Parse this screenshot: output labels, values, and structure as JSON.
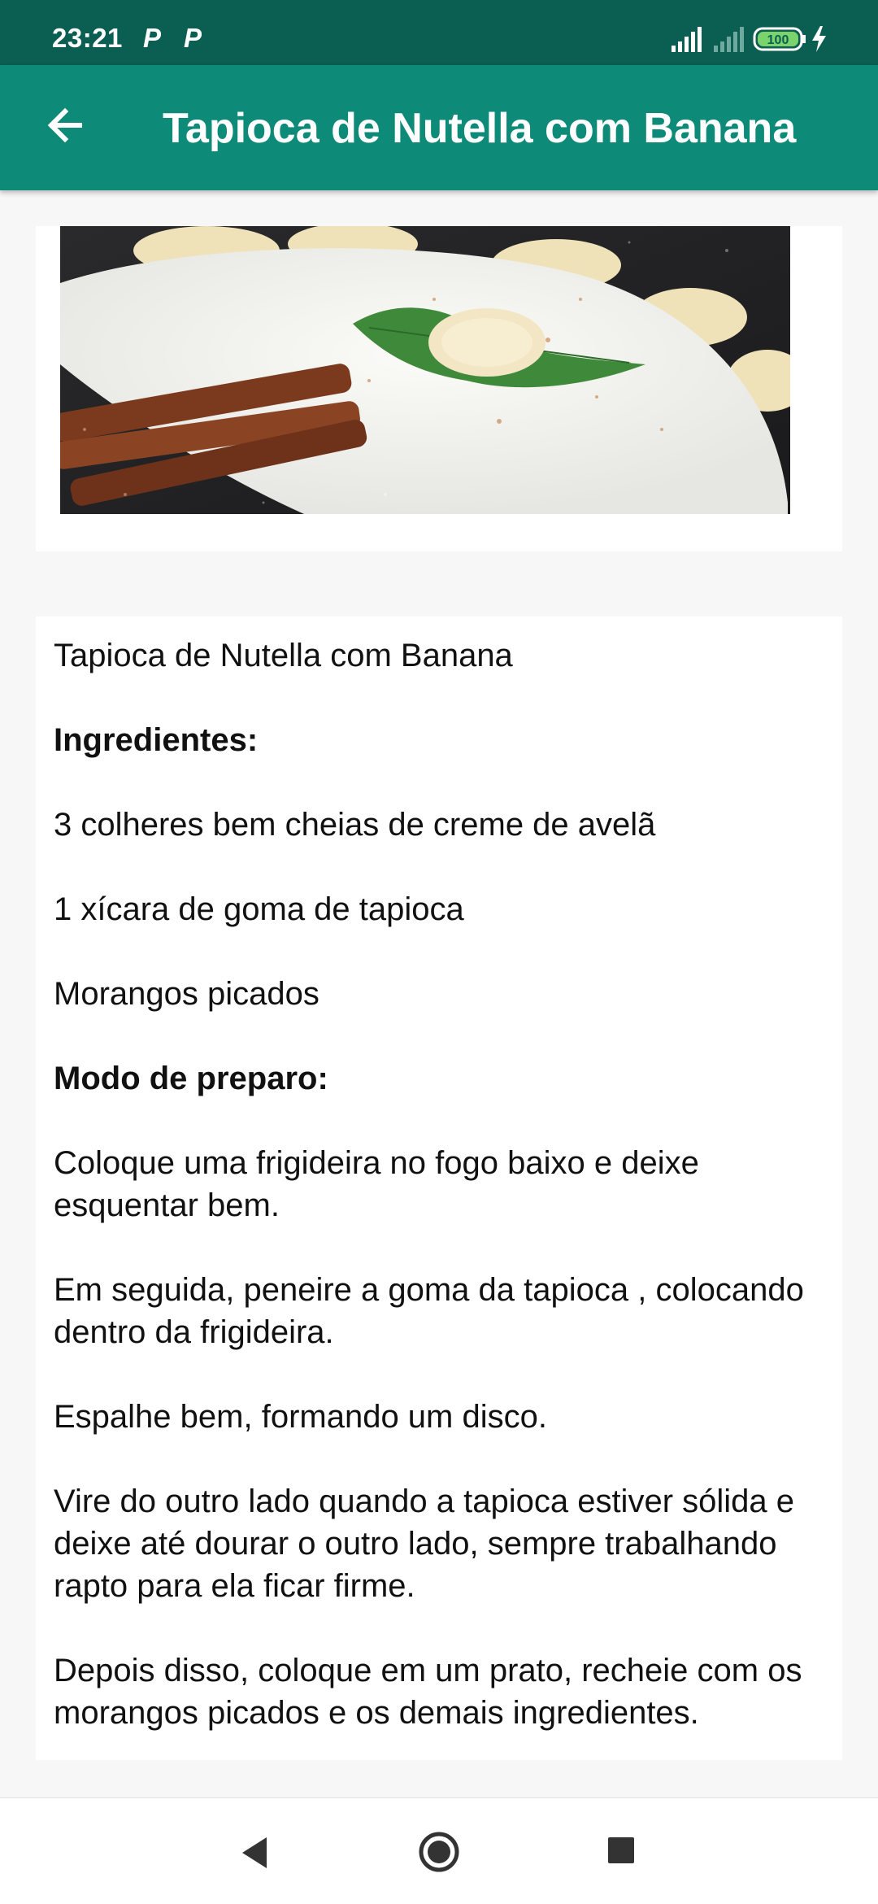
{
  "status_bar": {
    "time": "23:21",
    "notification_icons": [
      "parking-icon",
      "parking-icon"
    ],
    "battery_level": "100",
    "background_color": "#0b5e52"
  },
  "app_bar": {
    "title": "Tapioca de Nutella com Banana",
    "background_color": "#0e8a78",
    "back_icon": "arrow-left-icon"
  },
  "recipe": {
    "title": "Tapioca de Nutella com Banana",
    "ingredients_heading": "Ingredientes:",
    "ingredients": [
      "3 colheres bem cheias de creme de avelã",
      "1 xícara de goma de tapioca",
      "Morangos picados"
    ],
    "method_heading": "Modo de preparo:",
    "steps": [
      "Coloque uma frigideira no fogo baixo e deixe esquentar bem.",
      "Em seguida, peneire a goma da tapioca , colocando dentro da frigideira.",
      "Espalhe bem, formando um disco.",
      "Vire do outro lado quando a tapioca estiver sólida e deixe até dourar o outro lado, sempre trabalhando rapto para ela ficar firme.",
      "Depois disso, coloque em um prato, recheie com os morangos picados e os demais ingredientes."
    ]
  },
  "nav_bar": {
    "back_icon": "triangle-back-icon",
    "home_icon": "circle-home-icon",
    "recents_icon": "square-recents-icon"
  }
}
